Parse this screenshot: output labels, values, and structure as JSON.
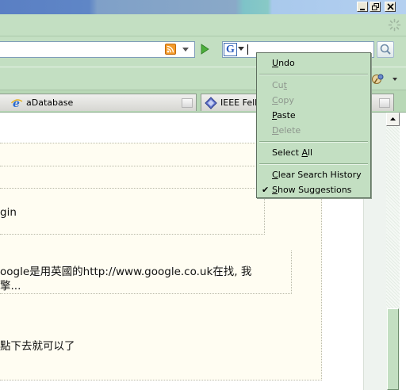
{
  "window": {
    "minimize_label": "_",
    "restore_label": "restore",
    "close_label": "close"
  },
  "toolbar": {
    "url_value": "",
    "search_value": "",
    "search_placeholder": ""
  },
  "tabs": [
    {
      "label": "aDatabase",
      "icon": "ie-icon"
    },
    {
      "label": "IEEE Fello",
      "icon": "ieee-diamond-icon"
    }
  ],
  "content": {
    "line_login": "gin",
    "line_google": "oogle是用英國的http://www.google.co.uk在找, 我",
    "line_cont": "擎...",
    "line_a": "",
    "line_b": "點下去就可以了"
  },
  "context_menu": {
    "items": [
      {
        "label": "Undo",
        "underline": "U",
        "rest": "ndo",
        "enabled": true
      },
      {
        "label": "Cut",
        "underline": "t",
        "rest_before": "Cu",
        "enabled": false
      },
      {
        "label": "Copy",
        "underline": "C",
        "rest": "opy",
        "enabled": false
      },
      {
        "label": "Paste",
        "underline": "P",
        "rest": "aste",
        "enabled": true
      },
      {
        "label": "Delete",
        "underline": "D",
        "rest": "elete",
        "enabled": false
      },
      {
        "label": "Select All",
        "enabled": true
      },
      {
        "label": "Clear Search History",
        "enabled": true
      },
      {
        "label": "Show Suggestions",
        "checked": true,
        "enabled": true
      }
    ]
  },
  "colors": {
    "chrome_green": "#c3dfc2",
    "content_cream": "#fffdf2",
    "disabled_text": "#8d968d"
  }
}
